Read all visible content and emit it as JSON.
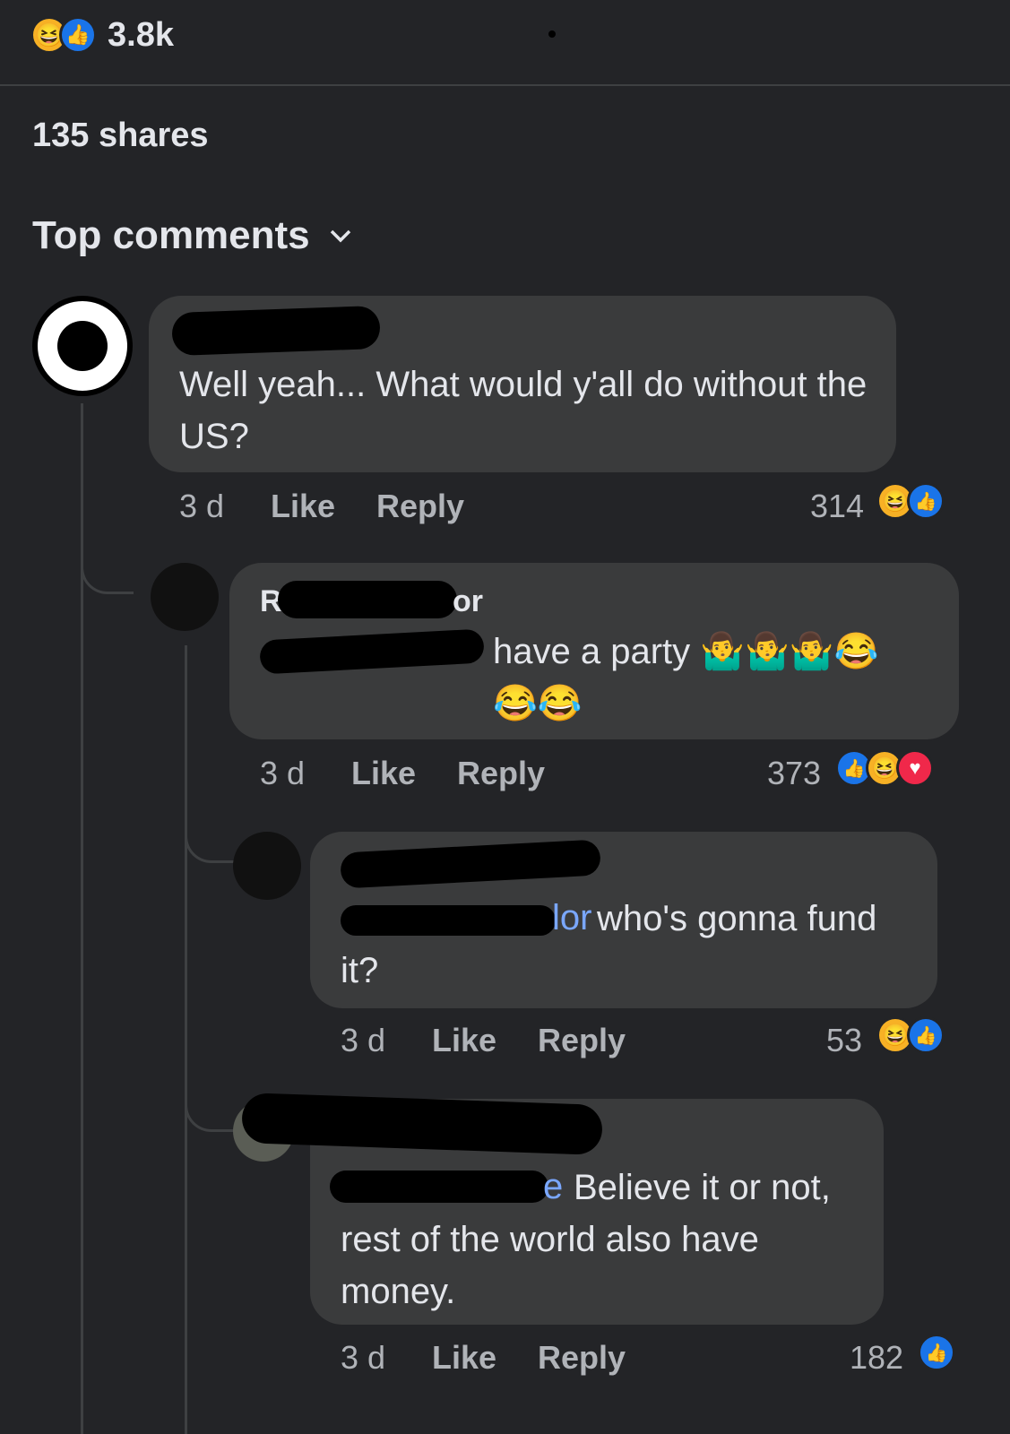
{
  "header": {
    "reaction_count": "3.8k",
    "shares": "135 shares",
    "sort_label": "Top comments"
  },
  "comments": [
    {
      "text": "Well yeah... What would y'all do without the US?",
      "time": "3 d",
      "like": "Like",
      "reply": "Reply",
      "count": "314",
      "reactions": [
        "haha",
        "like"
      ]
    },
    {
      "author_fragment": "R",
      "author_fragment2": "or",
      "text": "have a party 🤷‍♂️🤷‍♂️🤷‍♂️😂 😂😂",
      "time": "3 d",
      "like": "Like",
      "reply": "Reply",
      "count": "373",
      "reactions": [
        "like",
        "haha",
        "love"
      ]
    },
    {
      "mention_fragment": "lor",
      "text": "who's gonna fund it?",
      "time": "3 d",
      "like": "Like",
      "reply": "Reply",
      "count": "53",
      "reactions": [
        "haha",
        "like"
      ]
    },
    {
      "mention_fragment": "e",
      "text": "Believe it or not, rest of the world also have money.",
      "time": "3 d",
      "like": "Like",
      "reply": "Reply",
      "count": "182",
      "reactions": [
        "like"
      ]
    }
  ],
  "colors": {
    "background": "#232427",
    "bubble": "#3a3b3c",
    "accent_like": "#1a74e8",
    "haha": "#f7b125",
    "love": "#f0284a",
    "mention": "#7aa7ff"
  }
}
